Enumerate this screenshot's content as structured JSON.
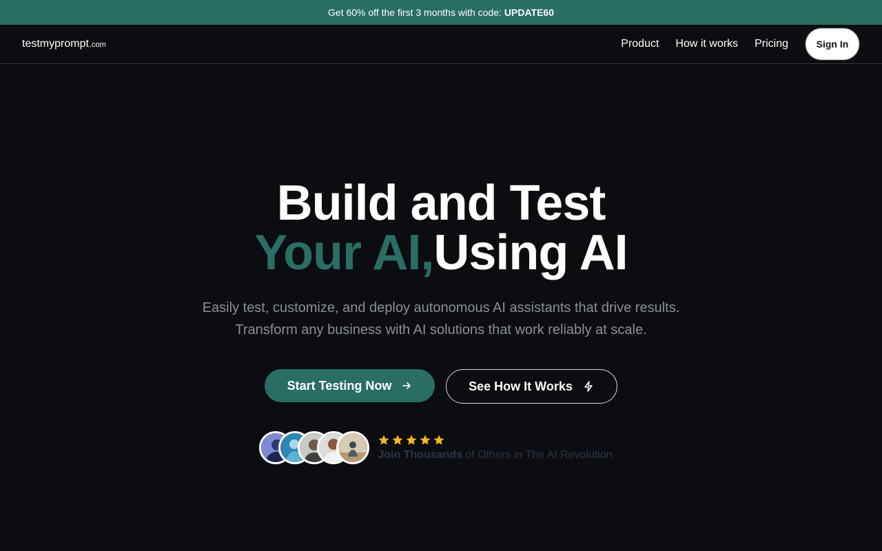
{
  "promo": {
    "text": "Get 60% off the first 3 months with code:",
    "code": "UPDATE60"
  },
  "nav": {
    "logo_main": "testmyprompt",
    "logo_tld": ".com",
    "links": [
      "Product",
      "How it works",
      "Pricing"
    ],
    "signin_label": "Sign In"
  },
  "hero": {
    "headline_line1": "Build and Test",
    "headline_accent": "Your AI,",
    "headline_rest": "Using AI",
    "subtitle_line1": "Easily test, customize, and deploy autonomous AI assistants that drive results.",
    "subtitle_line2": "Transform any business with AI solutions that work reliably at scale.",
    "primary_cta": "Start Testing Now",
    "secondary_cta": "See How It Works"
  },
  "social_proof": {
    "rating": 5,
    "tagline_strong": "Join Thousands",
    "tagline_rest": "of Others in The AI Revolution"
  },
  "colors": {
    "background": "#0c0d10",
    "accent": "#2a6e63",
    "star": "#f5b820",
    "muted_text": "#8b8f99"
  }
}
